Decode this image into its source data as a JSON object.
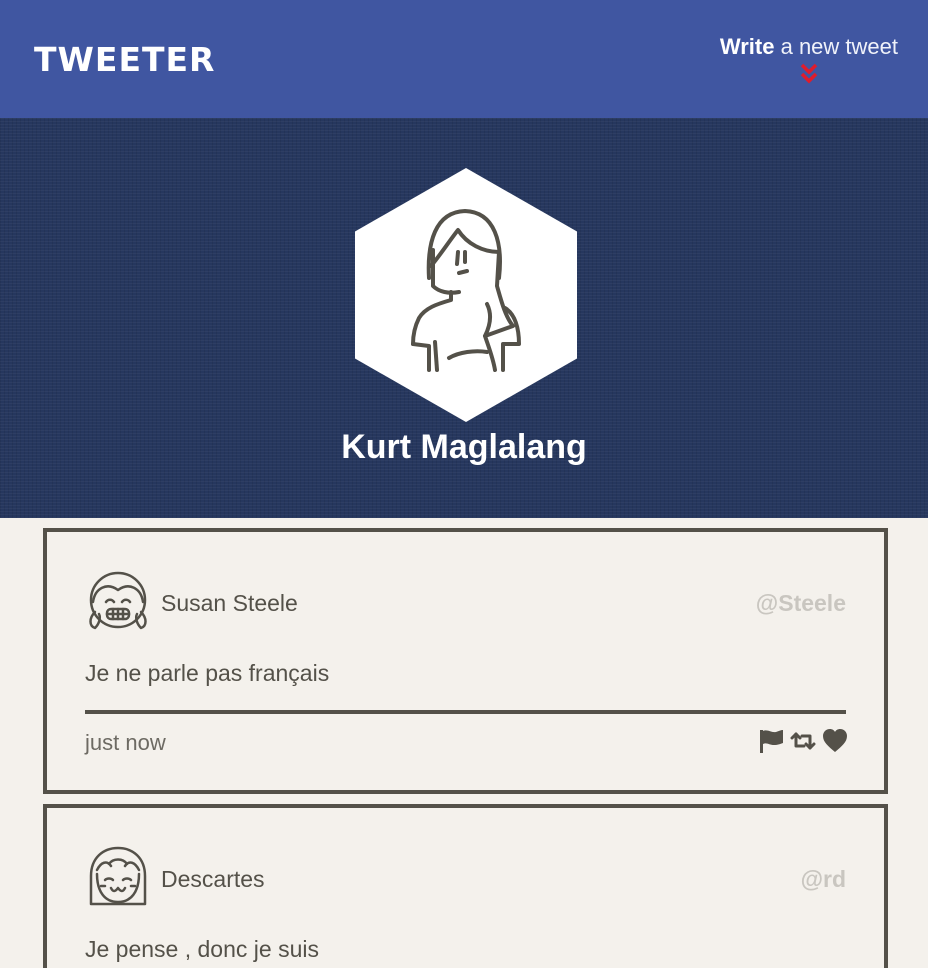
{
  "nav": {
    "logo": "TWEETER",
    "compose_strong": "Write",
    "compose_rest": "a new tweet",
    "compose_icon": "double-chevron-down-icon",
    "accent": "#e01c2c",
    "bg": "#4056a1"
  },
  "profile": {
    "name": "Kurt Maglalang",
    "avatar_icon": "person-avatar-icon",
    "bg": "#26375e"
  },
  "tweets": [
    {
      "name": "Susan Steele",
      "handle": "@Steele",
      "content": "Je ne parle pas français",
      "time": "just now",
      "avatar_icon": "smiling-girl-avatar-icon",
      "actions": [
        "flag-icon",
        "retweet-icon",
        "heart-icon"
      ]
    },
    {
      "name": "Descartes",
      "handle": "@rd",
      "content": "Je pense , donc je suis",
      "avatar_icon": "happy-girl-avatar-icon"
    }
  ],
  "colors": {
    "page_bg": "#f4f1ec",
    "ink": "#545149",
    "handle": "#c9c6c0"
  }
}
